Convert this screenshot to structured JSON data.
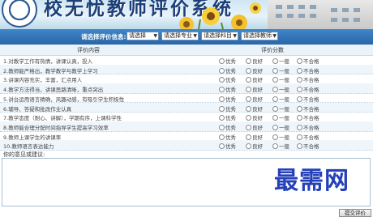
{
  "banner": {
    "title": "校无忧教师评价系统"
  },
  "selectbar": {
    "label": "请选择评价信息:",
    "selects": [
      "请选择",
      "请选择专业",
      "请选择科目",
      "请选择教师"
    ]
  },
  "table": {
    "header": {
      "content": "评价内容",
      "score": "评价分数"
    },
    "options": [
      "优秀",
      "良好",
      "一般",
      "不合格"
    ],
    "rows": [
      "1.对教学工作有热情，讲课认真，投入",
      "2.教师能严格出，教学教学与教学上学习",
      "3.讲课内容充实，丰富，汇点用人",
      "4.教学方法得当，讲课思路清晰，重点突出",
      "5.讲台运用语言精确，风趣动感，有吸引学生积极性",
      "6.辅导、答疑和批改作业认真",
      "7.教学态度（耐心、讲解），学期有序，上课科学性",
      "8.教师能合理分配时间指导学生提高学习效率",
      "9.教师上课学生的讲课率",
      "10.教师语言表达能力"
    ]
  },
  "comment": {
    "label": "你的意见或建议:"
  },
  "watermark": "最需网",
  "submit_label": "提交评价"
}
